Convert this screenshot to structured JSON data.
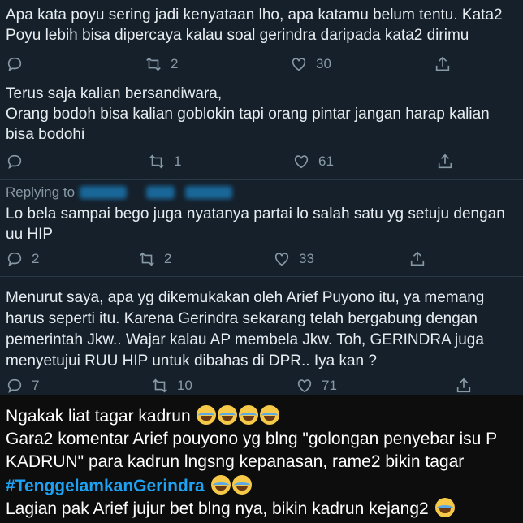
{
  "tweets": [
    {
      "text": "Apa kata poyu sering jadi kenyataan lho, apa katamu belum tentu. Kata2\nPoyu lebih bisa dipercaya kalau soal gerindra daripada kata2 dirimu",
      "reply_count": "",
      "retweet_count": "2",
      "like_count": "30"
    },
    {
      "text": "Terus saja kalian bersandiwara,\nOrang bodoh bisa kalian goblokin tapi orang pintar jangan harap kalian\nbisa bodohi",
      "reply_count": "",
      "retweet_count": "1",
      "like_count": "61"
    },
    {
      "replying_label": "Replying to",
      "text": "Lo bela sampai bego juga nyatanya partai lo salah satu yg setuju dengan\nuu HIP",
      "reply_count": "2",
      "retweet_count": "2",
      "like_count": "33"
    },
    {
      "text": "Menurut saya, apa yg dikemukakan oleh Arief Puyono itu, ya memang\nharus seperti itu. Karena Gerindra sekarang telah bergabung dengan\npemerintah Jkw.. Wajar kalau AP membela Jkw. Toh, GERINDRA juga\nmenyetujui RUU HIP untuk dibahas di DPR.. Iya kan ?",
      "reply_count": "7",
      "retweet_count": "10",
      "like_count": "71"
    }
  ],
  "comment": {
    "line1": "Ngakak liat tagar kadrun",
    "line2": "Gara2 komentar Arief pouyono yg blng \"golongan penyebar isu P",
    "line3": "KADRUN\" para kadrun lngsng kepanasan,  rame2 bikin tagar",
    "hashtag": "#TenggelamkanGerindra",
    "line5": "Lagian pak Arief jujur bet blng nya,  bikin kadrun kejang2"
  },
  "icons": [
    "reply-icon",
    "retweet-icon",
    "like-icon",
    "share-icon",
    "laughing-crying-emoji"
  ],
  "colors": {
    "background": "#15202b",
    "text": "#e7ecf0",
    "muted": "#8899a6",
    "link": "#1da1f2",
    "lower_panel": "#0d0d0d"
  }
}
